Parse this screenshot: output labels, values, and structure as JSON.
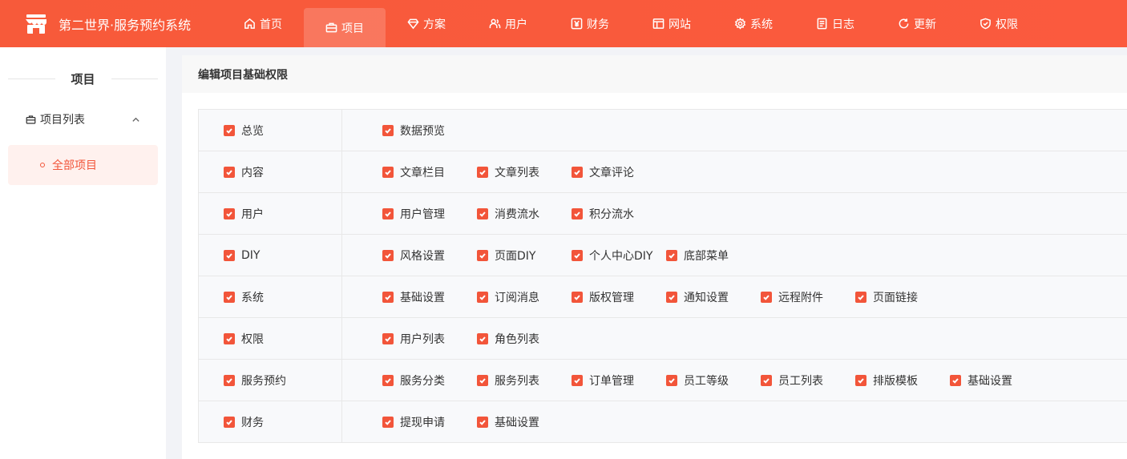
{
  "app": {
    "title": "第二世界·服务预约系统"
  },
  "nav": [
    {
      "label": "首页",
      "icon": "home-icon",
      "active": false
    },
    {
      "label": "项目",
      "icon": "briefcase-icon",
      "active": true
    },
    {
      "label": "方案",
      "icon": "diamond-icon",
      "active": false
    },
    {
      "label": "用户",
      "icon": "users-icon",
      "active": false
    },
    {
      "label": "财务",
      "icon": "yen-icon",
      "active": false
    },
    {
      "label": "网站",
      "icon": "layout-icon",
      "active": false
    },
    {
      "label": "系统",
      "icon": "gear-icon",
      "active": false
    },
    {
      "label": "日志",
      "icon": "document-icon",
      "active": false
    },
    {
      "label": "更新",
      "icon": "refresh-icon",
      "active": false
    },
    {
      "label": "权限",
      "icon": "shield-icon",
      "active": false
    }
  ],
  "sidebar": {
    "title": "项目",
    "group": {
      "label": "项目列表",
      "icon": "briefcase-icon"
    },
    "sub": {
      "label": "全部项目"
    }
  },
  "main": {
    "heading": "编辑项目基础权限"
  },
  "permissions": [
    {
      "label": "总览",
      "checked": true,
      "items": [
        "数据预览"
      ]
    },
    {
      "label": "内容",
      "checked": true,
      "items": [
        "文章栏目",
        "文章列表",
        "文章评论"
      ]
    },
    {
      "label": "用户",
      "checked": true,
      "items": [
        "用户管理",
        "消费流水",
        "积分流水"
      ]
    },
    {
      "label": "DIY",
      "checked": true,
      "items": [
        "风格设置",
        "页面DIY",
        "个人中心DIY",
        "底部菜单"
      ]
    },
    {
      "label": "系统",
      "checked": true,
      "items": [
        "基础设置",
        "订阅消息",
        "版权管理",
        "通知设置",
        "远程附件",
        "页面链接"
      ]
    },
    {
      "label": "权限",
      "checked": true,
      "items": [
        "用户列表",
        "角色列表"
      ]
    },
    {
      "label": "服务预约",
      "checked": true,
      "items": [
        "服务分类",
        "服务列表",
        "订单管理",
        "员工等级",
        "员工列表",
        "排版模板",
        "基础设置"
      ]
    },
    {
      "label": "财务",
      "checked": true,
      "items": [
        "提现申请",
        "基础设置"
      ]
    }
  ],
  "colors": {
    "accent": "#f2553a",
    "header": "#f75a3a"
  }
}
